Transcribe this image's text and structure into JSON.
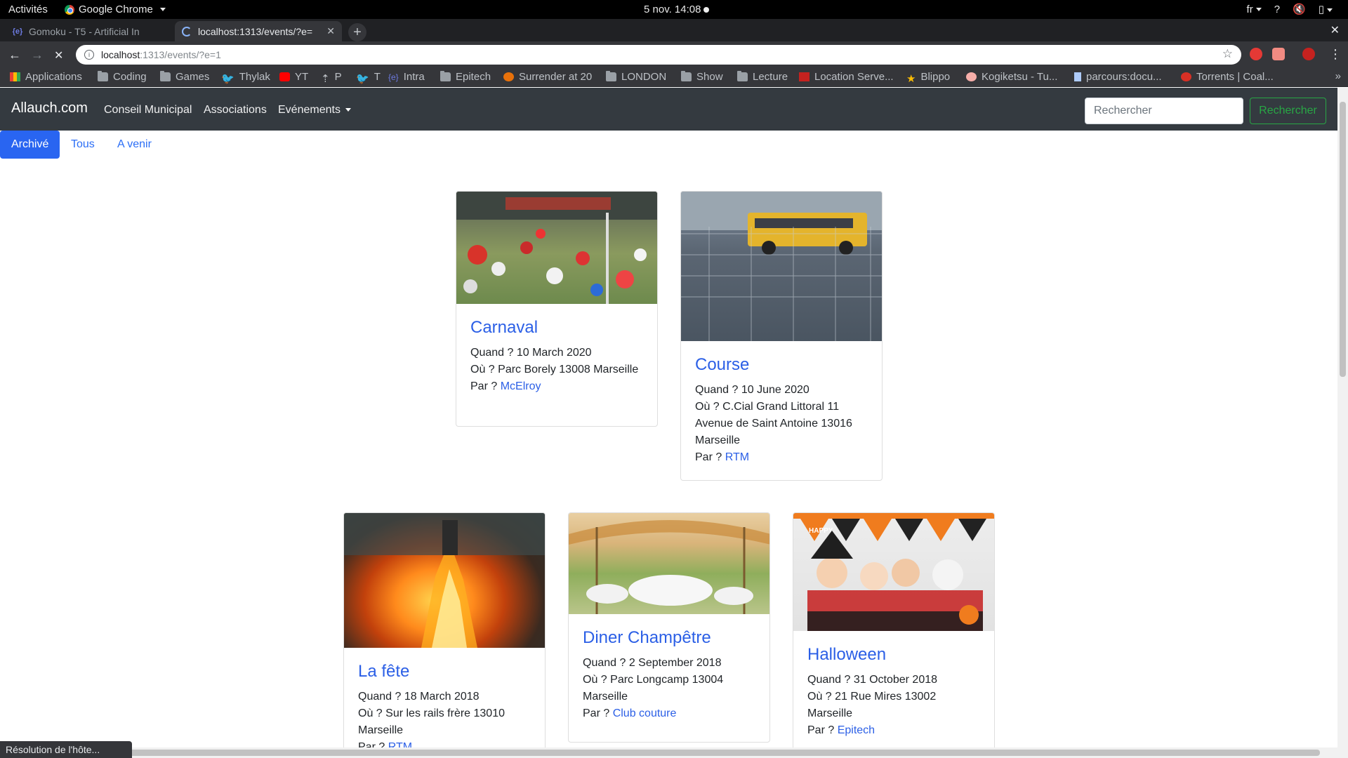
{
  "os_bar": {
    "activities": "Activités",
    "app_name": "Google Chrome",
    "clock": "5 nov.  14:08",
    "lang": "fr"
  },
  "browser": {
    "tabs": [
      {
        "title": "Gomoku - T5 - Artificial In",
        "favicon": "epitech-icon"
      },
      {
        "title": "localhost:1313/events/?e=",
        "favicon": "loading-spinner"
      }
    ],
    "url_host": "localhost",
    "url_rest": ":1313/events/?e=1",
    "bookmarks": [
      {
        "label": "Applications",
        "icon": "apps-grid-icon"
      },
      {
        "label": "Coding",
        "icon": "folder-icon"
      },
      {
        "label": "Games",
        "icon": "folder-icon"
      },
      {
        "label": "Thylak",
        "icon": "twitter-icon"
      },
      {
        "label": "YT",
        "icon": "youtube-icon"
      },
      {
        "label": "P",
        "icon": "bookmark-icon"
      },
      {
        "label": "T",
        "icon": "twitter-icon"
      },
      {
        "label": "Intra",
        "icon": "epitech-icon"
      },
      {
        "label": "Epitech",
        "icon": "folder-icon"
      },
      {
        "label": "Surrender at 20",
        "icon": "surrender-icon"
      },
      {
        "label": "LONDON",
        "icon": "folder-icon"
      },
      {
        "label": "Show",
        "icon": "folder-icon"
      },
      {
        "label": "Lecture",
        "icon": "folder-icon"
      },
      {
        "label": "Location Serve...",
        "icon": "location-icon"
      },
      {
        "label": "Blippo",
        "icon": "star-icon"
      },
      {
        "label": "Kogiketsu - Tu...",
        "icon": "kogiketsu-icon"
      },
      {
        "label": "parcours:docu...",
        "icon": "doc-icon"
      },
      {
        "label": "Torrents | Coal...",
        "icon": "torrent-icon"
      }
    ],
    "status_text": "Résolution de l'hôte..."
  },
  "site": {
    "brand": "Allauch.com",
    "nav": [
      "Conseil Municipal",
      "Associations",
      "Evénements"
    ],
    "search_placeholder": "Rechercher",
    "search_button": "Rechercher",
    "filters": [
      {
        "label": "Archivé",
        "active": true
      },
      {
        "label": "Tous",
        "active": false
      },
      {
        "label": "A venir",
        "active": false
      }
    ],
    "labels": {
      "when": "Quand ? ",
      "where": "Où ? ",
      "by": "Par ? "
    }
  },
  "events": [
    {
      "title": "Carnaval",
      "date": "10 March 2020",
      "where_1": "Parc Borely 13008 Marseille",
      "where_2": "",
      "where_3": "",
      "organizer": "McElroy"
    },
    {
      "title": "Course",
      "date": "10 June 2020",
      "where_1": "C.Cial Grand Littoral 11",
      "where_2": "Avenue de Saint Antoine 13016",
      "where_3": "Marseille",
      "organizer": "RTM"
    },
    {
      "title": "La fête",
      "date": "18 March 2018",
      "where_1": "Sur les rails frère 13010",
      "where_2": "Marseille",
      "where_3": "",
      "organizer": "RTM"
    },
    {
      "title": "Diner Champêtre",
      "date": "2 September 2018",
      "where_1": "Parc Longcamp 13004",
      "where_2": "Marseille",
      "where_3": "",
      "organizer": "Club couture"
    },
    {
      "title": "Halloween",
      "date": "31 October 2018",
      "where_1": "21 Rue Mires 13002",
      "where_2": "Marseille",
      "where_3": "",
      "organizer": "Epitech"
    }
  ],
  "halloween_banner": "HAPPY"
}
